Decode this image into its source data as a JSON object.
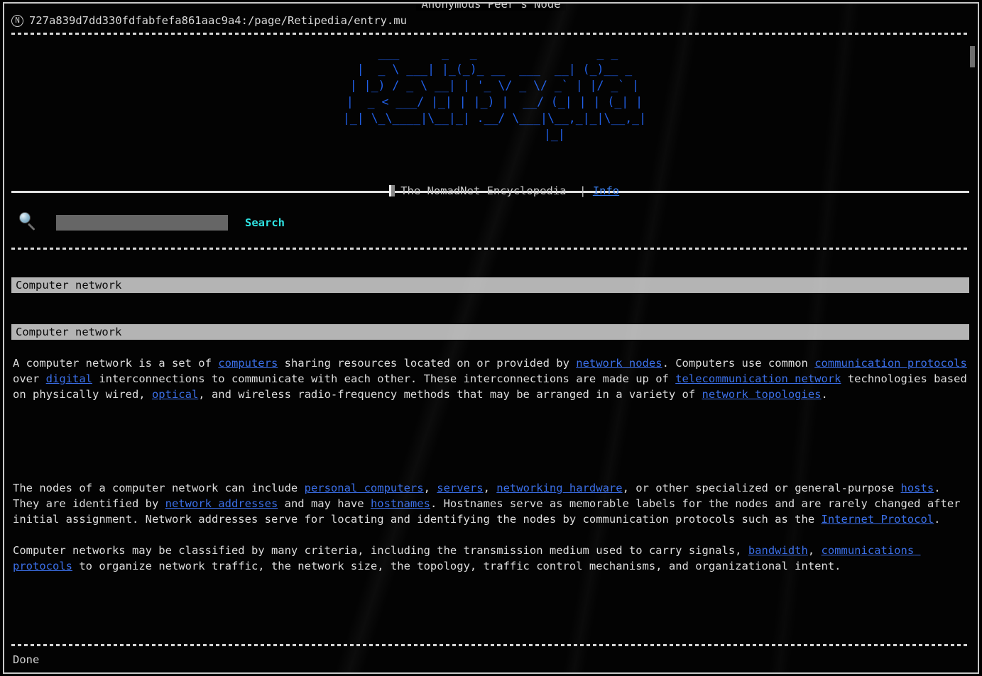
{
  "window": {
    "title": "Anonymous Peer's Node"
  },
  "location": {
    "badge_glyph": "N",
    "url": "727a839d7dd330fdfabfefa861aac9a4:/page/Retipedia/entry.mu"
  },
  "logo": {
    "alt_text": "Retipedia",
    "color": "#2160e8",
    "lines": [
      "  ___      _   _                 _ _",
      " |  _ \\ ___| |_(_)_ __  ___  __| (_)__ _",
      " | |_) / _ \\ __| | '_ \\/ _ \\/ _` | |/ _` |",
      " |  _ < ___/ |_| | |_) |  __/ (_| | | (_| |",
      " |_| \\_\\____|\\__|_| .__/ \\___|\\__,_|_|\\__,_|",
      "                  |_|"
    ]
  },
  "tagline": {
    "flag_icon": "flag-icon",
    "text": "The NomadNet Encyclopedia  | ",
    "info_link": "Info"
  },
  "search": {
    "icon": "magnifier-icon",
    "value": "",
    "placeholder": "",
    "button_label": "Search",
    "accent_color": "#2fe3e3"
  },
  "page": {
    "title_bar": "Computer network",
    "heading_bar": "Computer network"
  },
  "article": {
    "paragraphs": [
      {
        "segments": [
          {
            "t": "A computer network is a set of ",
            "link": false
          },
          {
            "t": "computers",
            "link": true
          },
          {
            "t": " sharing resources located on or provided by ",
            "link": false
          },
          {
            "t": "network nodes",
            "link": true
          },
          {
            "t": ". Computers use common ",
            "link": false
          },
          {
            "t": "communication protocols",
            "link": true
          },
          {
            "t": " over ",
            "link": false
          },
          {
            "t": "digital",
            "link": true
          },
          {
            "t": " interconnections to communicate with each other. These interconnections are made up of ",
            "link": false
          },
          {
            "t": "telecommunication network",
            "link": true
          },
          {
            "t": " technologies based on physically wired, ",
            "link": false
          },
          {
            "t": "optical",
            "link": true
          },
          {
            "t": ", and wireless radio-frequency methods that may be arranged in a variety of ",
            "link": false
          },
          {
            "t": "network topologies",
            "link": true
          },
          {
            "t": ".",
            "link": false
          }
        ]
      },
      {
        "segments": [
          {
            "t": "The nodes of a computer network can include ",
            "link": false
          },
          {
            "t": "personal computers",
            "link": true
          },
          {
            "t": ", ",
            "link": false
          },
          {
            "t": "servers",
            "link": true
          },
          {
            "t": ", ",
            "link": false
          },
          {
            "t": "networking hardware",
            "link": true
          },
          {
            "t": ", or other specialized or general-purpose ",
            "link": false
          },
          {
            "t": "hosts",
            "link": true
          },
          {
            "t": ". They are identified by ",
            "link": false
          },
          {
            "t": "network addresses",
            "link": true
          },
          {
            "t": " and may have ",
            "link": false
          },
          {
            "t": "hostnames",
            "link": true
          },
          {
            "t": ". Hostnames serve as memorable labels for the nodes and are rarely changed after initial assignment. Network addresses serve for locating and identifying the nodes by communication protocols such as the ",
            "link": false
          },
          {
            "t": "Internet Protocol",
            "link": true
          },
          {
            "t": ".",
            "link": false
          }
        ]
      },
      {
        "segments": [
          {
            "t": "Computer networks may be classified by many criteria, including the transmission medium used to carry signals, ",
            "link": false
          },
          {
            "t": "bandwidth",
            "link": true
          },
          {
            "t": ", ",
            "link": false
          },
          {
            "t": "communications protocols",
            "link": true
          },
          {
            "t": " to organize network traffic, the network size, the topology, traffic control mechanisms, and organizational intent.",
            "link": false
          }
        ]
      }
    ]
  },
  "status": {
    "text": "Done"
  },
  "scrollbar": {
    "thumb_color": "#6e6e6e"
  }
}
